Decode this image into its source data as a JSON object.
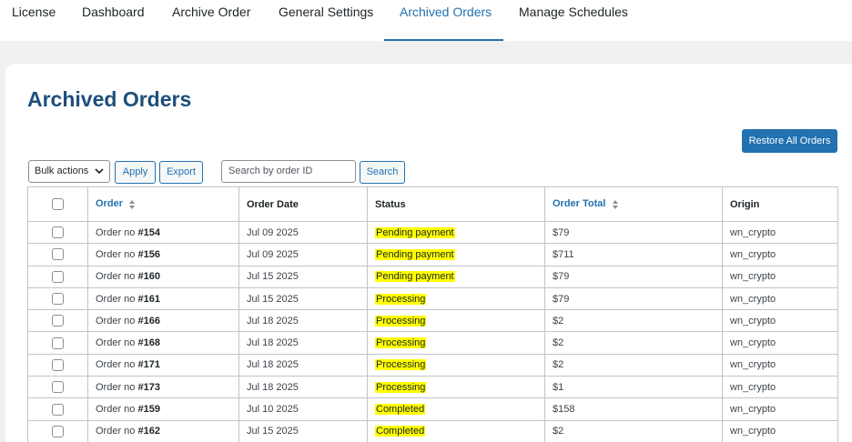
{
  "nav": {
    "tabs": [
      {
        "label": "License"
      },
      {
        "label": "Dashboard"
      },
      {
        "label": "Archive Order"
      },
      {
        "label": "General Settings"
      },
      {
        "label": "Archived Orders"
      },
      {
        "label": "Manage Schedules"
      }
    ],
    "active_tab": "Archived Orders"
  },
  "page": {
    "title": "Archived Orders",
    "restore_button": "Restore All Orders"
  },
  "toolbar": {
    "bulk_actions": "Bulk actions",
    "apply": "Apply",
    "export": "Export",
    "search_placeholder": "Search by order ID",
    "search_button": "Search"
  },
  "table": {
    "headers": {
      "order": "Order",
      "order_date": "Order Date",
      "status": "Status",
      "order_total": "Order Total",
      "origin": "Origin"
    },
    "rows": [
      {
        "prefix": "Order no ",
        "id": "#154",
        "date": "Jul 09 2025",
        "status": "Pending payment",
        "total": "$79",
        "origin": "wn_crypto"
      },
      {
        "prefix": "Order no ",
        "id": "#156",
        "date": "Jul 09 2025",
        "status": "Pending payment",
        "total": "$711",
        "origin": "wn_crypto"
      },
      {
        "prefix": "Order no ",
        "id": "#160",
        "date": "Jul 15 2025",
        "status": "Pending payment",
        "total": "$79",
        "origin": "wn_crypto"
      },
      {
        "prefix": "Order no ",
        "id": "#161",
        "date": "Jul 15 2025",
        "status": "Processing",
        "total": "$79",
        "origin": "wn_crypto"
      },
      {
        "prefix": "Order no ",
        "id": "#166",
        "date": "Jul 18 2025",
        "status": "Processing",
        "total": "$2",
        "origin": "wn_crypto"
      },
      {
        "prefix": "Order no ",
        "id": "#168",
        "date": "Jul 18 2025",
        "status": "Processing",
        "total": "$2",
        "origin": "wn_crypto"
      },
      {
        "prefix": "Order no ",
        "id": "#171",
        "date": "Jul 18 2025",
        "status": "Processing",
        "total": "$2",
        "origin": "wn_crypto"
      },
      {
        "prefix": "Order no ",
        "id": "#173",
        "date": "Jul 18 2025",
        "status": "Processing",
        "total": "$1",
        "origin": "wn_crypto"
      },
      {
        "prefix": "Order no ",
        "id": "#159",
        "date": "Jul 10 2025",
        "status": "Completed",
        "total": "$158",
        "origin": "wn_crypto"
      },
      {
        "prefix": "Order no ",
        "id": "#162",
        "date": "Jul 15 2025",
        "status": "Completed",
        "total": "$2",
        "origin": "wn_crypto"
      }
    ]
  },
  "colors": {
    "accent": "#2271b1",
    "title": "#1e4f7a",
    "status_highlight": "#ffff00",
    "background": "#f0f0f1"
  }
}
